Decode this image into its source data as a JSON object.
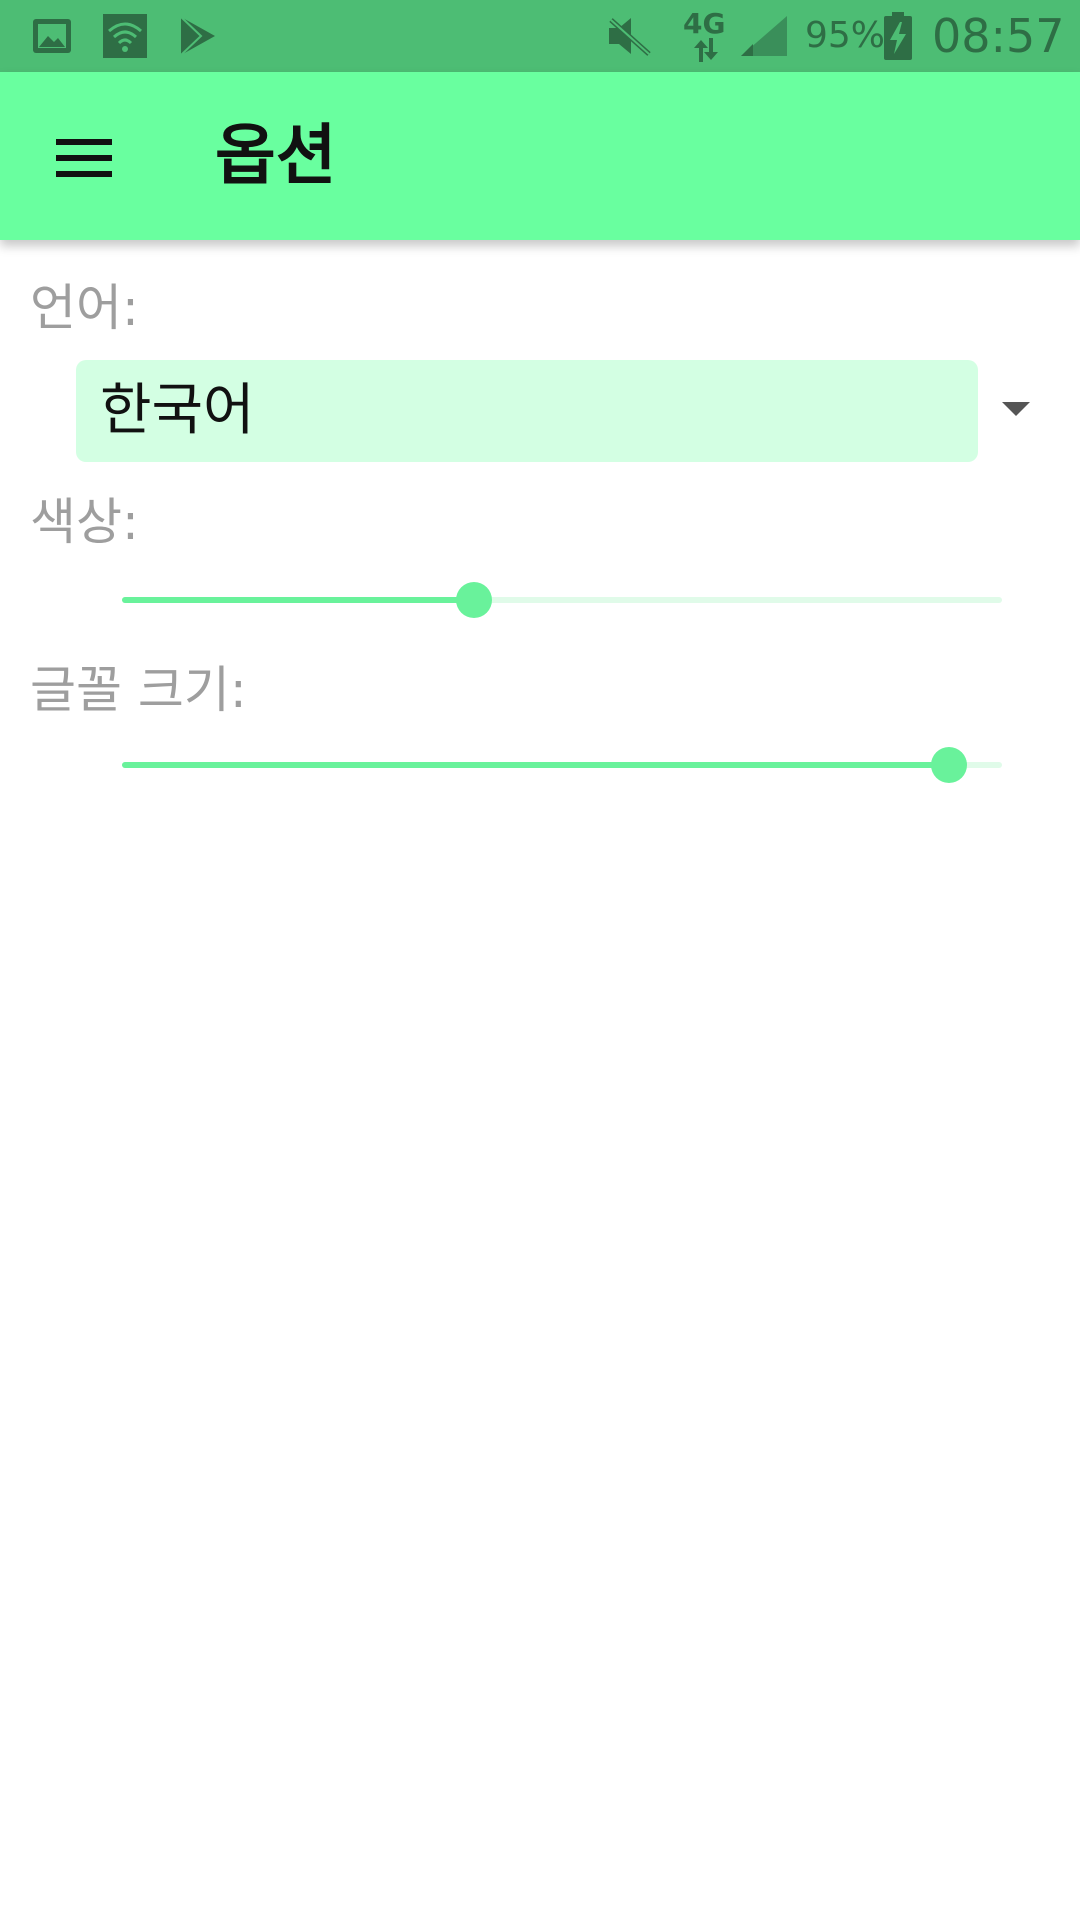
{
  "status_bar": {
    "network": "4G",
    "battery": "95%",
    "time": "08:57",
    "icons": [
      "gallery-icon",
      "wifi-icon",
      "play-store-icon",
      "mute-icon",
      "signal-icon",
      "battery-charging-icon"
    ]
  },
  "app_bar": {
    "menu_icon": "menu-icon",
    "title": "옵션",
    "background": "#69ff9f"
  },
  "settings": {
    "language": {
      "label": "언어:",
      "selected": "한국어"
    },
    "color": {
      "label": "색상:",
      "value_fraction": 0.4
    },
    "font_size": {
      "label": "글꼴 크기:",
      "value_fraction": 0.94
    }
  },
  "colors": {
    "accent": "#69ff9f",
    "status_bar": "#4dbd74",
    "spinner_bg": "#d3ffe3",
    "label_text": "#9e9e9e"
  }
}
